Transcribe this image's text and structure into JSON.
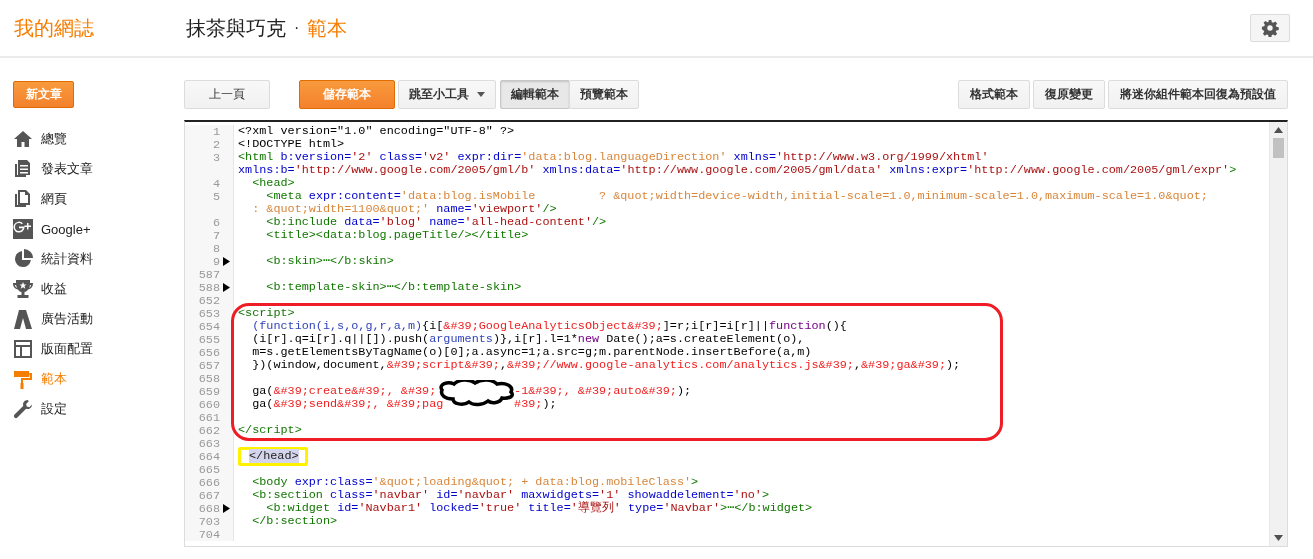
{
  "header": {
    "logo": "我的網誌",
    "blog_title": "抹茶與巧克",
    "separator": "·",
    "page_title": "範本"
  },
  "sidebar": {
    "new_post": "新文章",
    "items": [
      {
        "label": "總覽",
        "selected": false
      },
      {
        "label": "發表文章",
        "selected": false
      },
      {
        "label": "網頁",
        "selected": false
      },
      {
        "label": "Google+",
        "selected": false
      },
      {
        "label": "統計資料",
        "selected": false
      },
      {
        "label": "收益",
        "selected": false
      },
      {
        "label": "廣告活動",
        "selected": false
      },
      {
        "label": "版面配置",
        "selected": false
      },
      {
        "label": "範本",
        "selected": true
      },
      {
        "label": "設定",
        "selected": false
      }
    ]
  },
  "toolbar": {
    "left": [
      {
        "label": "上一頁",
        "kind": "plain"
      },
      {
        "label": "儲存範本",
        "kind": "primary"
      },
      {
        "label": "跳至小工具",
        "kind": "dropdown"
      }
    ],
    "view_toggle": [
      {
        "label": "編輯範本",
        "selected": true
      },
      {
        "label": "預覽範本",
        "selected": false
      }
    ],
    "right": [
      {
        "label": "格式範本",
        "kind": "plain"
      },
      {
        "label": "復原變更",
        "kind": "plain"
      },
      {
        "label": "將迷你組件範本回復為預設值",
        "kind": "plain"
      }
    ]
  },
  "editor": {
    "lines": [
      {
        "number": "1",
        "folded": false,
        "kind": "plain",
        "tokens": [
          {
            "kind": "plain",
            "text": "<?xml version=\"1.0\" encoding=\"UTF-8\" ?>"
          }
        ]
      },
      {
        "number": "2",
        "folded": false,
        "kind": "plain",
        "tokens": [
          {
            "kind": "plain",
            "text": "<!DOCTYPE html>"
          }
        ]
      },
      {
        "number": "3",
        "folded": false,
        "kind": "plain",
        "tokens": [
          {
            "kind": "tag",
            "text": "<html "
          },
          {
            "kind": "attr",
            "text": "b:version="
          },
          {
            "kind": "str",
            "text": "'2' "
          },
          {
            "kind": "attr",
            "text": "class="
          },
          {
            "kind": "str",
            "text": "'v2' "
          },
          {
            "kind": "attr",
            "text": "expr:dir="
          },
          {
            "kind": "expr",
            "text": "'data:blog.languageDirection' "
          },
          {
            "kind": "attr",
            "text": "xmlns="
          },
          {
            "kind": "str",
            "text": "'http://www.w3.org/1999/xhtml'"
          },
          {
            "kind": "wrap"
          },
          {
            "kind": "attr",
            "text": "xmlns:b="
          },
          {
            "kind": "str",
            "text": "'http://www.google.com/2005/gml/b' "
          },
          {
            "kind": "attr",
            "text": "xmlns:data="
          },
          {
            "kind": "str",
            "text": "'http://www.google.com/2005/gml/data' "
          },
          {
            "kind": "attr",
            "text": "xmlns:expr="
          },
          {
            "kind": "str",
            "text": "'http://www.google.com/2005/gml/expr'"
          },
          {
            "kind": "tag",
            "text": ">"
          }
        ]
      },
      {
        "number": "4",
        "folded": false,
        "kind": "plain",
        "tokens": [
          {
            "kind": "tag",
            "text": "  <head>"
          }
        ]
      },
      {
        "number": "5",
        "folded": false,
        "kind": "plain",
        "tokens": [
          {
            "kind": "tag",
            "text": "    <meta "
          },
          {
            "kind": "attr",
            "text": "expr:content="
          },
          {
            "kind": "expr",
            "text": "'data:blog.isMobile         ? &quot;width=device-width,initial-scale=1.0,minimum-scale=1.0,maximum-scale=1.0&quot;"
          },
          {
            "kind": "wrap"
          },
          {
            "kind": "expr",
            "text": "  : &quot;width=1100&quot;' "
          },
          {
            "kind": "attr",
            "text": "name="
          },
          {
            "kind": "str",
            "text": "'viewport'"
          },
          {
            "kind": "tag",
            "text": "/>"
          }
        ]
      },
      {
        "number": "6",
        "folded": false,
        "kind": "plain",
        "tokens": [
          {
            "kind": "tag",
            "text": "    <b:include "
          },
          {
            "kind": "attr",
            "text": "data="
          },
          {
            "kind": "str",
            "text": "'blog' "
          },
          {
            "kind": "attr",
            "text": "name="
          },
          {
            "kind": "str",
            "text": "'all-head-content'"
          },
          {
            "kind": "tag",
            "text": "/>"
          }
        ]
      },
      {
        "number": "7",
        "folded": false,
        "kind": "plain",
        "tokens": [
          {
            "kind": "tag",
            "text": "    <title><data:blog.pageTitle/></title>"
          }
        ]
      },
      {
        "number": "8",
        "folded": false,
        "kind": "plain"
      },
      {
        "number": "9",
        "folded": true,
        "kind": "plain",
        "tokens": [
          {
            "kind": "tag",
            "text": "    <b:skin>"
          },
          {
            "kind": "fold",
            "text": "⋯"
          },
          {
            "kind": "tag",
            "text": "</b:skin>"
          }
        ]
      },
      {
        "number": "587",
        "folded": false,
        "kind": "plain"
      },
      {
        "number": "588",
        "folded": true,
        "kind": "plain",
        "tokens": [
          {
            "kind": "tag",
            "text": "    <b:template-skin>"
          },
          {
            "kind": "fold",
            "text": "⋯"
          },
          {
            "kind": "tag",
            "text": "</b:template-skin>"
          }
        ]
      },
      {
        "number": "652",
        "folded": false,
        "kind": "plain"
      },
      {
        "number": "653",
        "folded": false,
        "kind": "framed",
        "tokens": [
          {
            "kind": "tag",
            "text": "<script>"
          }
        ]
      },
      {
        "number": "654",
        "folded": false,
        "kind": "framed",
        "tokens": [
          {
            "kind": "var",
            "text": "  (function(i,s,o,g,r,a,m)"
          },
          {
            "kind": "plain",
            "text": "{i["
          },
          {
            "kind": "jsstr",
            "text": "&#39;GoogleAnalyticsObject&#39;"
          },
          {
            "kind": "plain",
            "text": "]=r;i[r]=i[r]||"
          },
          {
            "kind": "key",
            "text": "function"
          },
          {
            "kind": "plain",
            "text": "(){"
          }
        ]
      },
      {
        "number": "655",
        "folded": false,
        "kind": "framed",
        "tokens": [
          {
            "kind": "plain",
            "text": "  (i[r].q=i[r].q||[]).push("
          },
          {
            "kind": "var",
            "text": "arguments"
          },
          {
            "kind": "plain",
            "text": ")},i[r].l=1*"
          },
          {
            "kind": "key",
            "text": "new"
          },
          {
            "kind": "plain",
            "text": " Date();a=s.createElement(o),"
          }
        ]
      },
      {
        "number": "656",
        "folded": false,
        "kind": "framed",
        "tokens": [
          {
            "kind": "plain",
            "text": "  m=s.getElementsByTagName(o)[0];a.async=1;a.src=g;m.parentNode.insertBefore(a,m)"
          }
        ]
      },
      {
        "number": "657",
        "folded": false,
        "kind": "framed",
        "tokens": [
          {
            "kind": "plain",
            "text": "  })(window,document,"
          },
          {
            "kind": "jsstr",
            "text": "&#39;script&#39;"
          },
          {
            "kind": "plain",
            "text": ","
          },
          {
            "kind": "jsstr",
            "text": "&#39;//www.google-analytics.com/analytics.js&#39;"
          },
          {
            "kind": "plain",
            "text": ","
          },
          {
            "kind": "jsstr",
            "text": "&#39;ga&#39;"
          },
          {
            "kind": "plain",
            "text": ");"
          }
        ]
      },
      {
        "number": "658",
        "folded": false,
        "kind": "framed"
      },
      {
        "number": "659",
        "folded": false,
        "kind": "framed",
        "tokens": [
          {
            "kind": "plain",
            "text": "  ga("
          },
          {
            "kind": "jsstr",
            "text": "&#39;create&#39;, &#39;"
          },
          {
            "kind": "scribbled"
          },
          {
            "kind": "jsstr",
            "text": "-1&#39;, &#39;auto&#39;"
          },
          {
            "kind": "plain",
            "text": ");"
          }
        ]
      },
      {
        "number": "660",
        "folded": false,
        "kind": "framed",
        "tokens": [
          {
            "kind": "plain",
            "text": "  ga("
          },
          {
            "kind": "jsstr",
            "text": "&#39;send&#39;, &#39;pag"
          },
          {
            "kind": "covered"
          },
          {
            "kind": "jsstr",
            "text": "#39;"
          },
          {
            "kind": "plain",
            "text": ");"
          }
        ]
      },
      {
        "number": "661",
        "folded": false,
        "kind": "framed"
      },
      {
        "number": "662",
        "folded": false,
        "kind": "framed",
        "tokens": [
          {
            "kind": "tag",
            "text": "</script>"
          }
        ]
      },
      {
        "number": "663",
        "folded": false,
        "kind": "plain"
      },
      {
        "number": "664",
        "folded": false,
        "kind": "ringed",
        "tokens": [
          {
            "kind": "selected",
            "text": "</head>"
          }
        ]
      },
      {
        "number": "665",
        "folded": false,
        "kind": "plain"
      },
      {
        "number": "666",
        "folded": false,
        "kind": "plain",
        "tokens": [
          {
            "kind": "tag",
            "text": "  <body "
          },
          {
            "kind": "attr",
            "text": "expr:class="
          },
          {
            "kind": "expr",
            "text": "'&quot;loading&quot; + data:blog.mobileClass'"
          },
          {
            "kind": "tag",
            "text": ">"
          }
        ]
      },
      {
        "number": "667",
        "folded": false,
        "kind": "plain",
        "tokens": [
          {
            "kind": "tag",
            "text": "  <b:section "
          },
          {
            "kind": "attr",
            "text": "class="
          },
          {
            "kind": "str",
            "text": "'navbar' "
          },
          {
            "kind": "attr",
            "text": "id="
          },
          {
            "kind": "str",
            "text": "'navbar' "
          },
          {
            "kind": "attr",
            "text": "maxwidgets="
          },
          {
            "kind": "str",
            "text": "'1' "
          },
          {
            "kind": "attr",
            "text": "showaddelement="
          },
          {
            "kind": "str",
            "text": "'no'"
          },
          {
            "kind": "tag",
            "text": ">"
          }
        ]
      },
      {
        "number": "668",
        "folded": true,
        "kind": "plain",
        "tokens": [
          {
            "kind": "tag",
            "text": "    <b:widget "
          },
          {
            "kind": "attr",
            "text": "id="
          },
          {
            "kind": "str",
            "text": "'Navbar1' "
          },
          {
            "kind": "attr",
            "text": "locked="
          },
          {
            "kind": "str",
            "text": "'true' "
          },
          {
            "kind": "attr",
            "text": "title="
          },
          {
            "kind": "str",
            "text": "'導覽列' "
          },
          {
            "kind": "attr",
            "text": "type="
          },
          {
            "kind": "str",
            "text": "'Navbar'"
          },
          {
            "kind": "tag",
            "text": ">"
          },
          {
            "kind": "fold",
            "text": "⋯"
          },
          {
            "kind": "tag",
            "text": "</b:widget>"
          }
        ]
      },
      {
        "number": "703",
        "folded": false,
        "kind": "plain",
        "tokens": [
          {
            "kind": "tag",
            "text": "  </b:section>"
          }
        ]
      },
      {
        "number": "704",
        "folded": false,
        "kind": "plain"
      }
    ]
  }
}
